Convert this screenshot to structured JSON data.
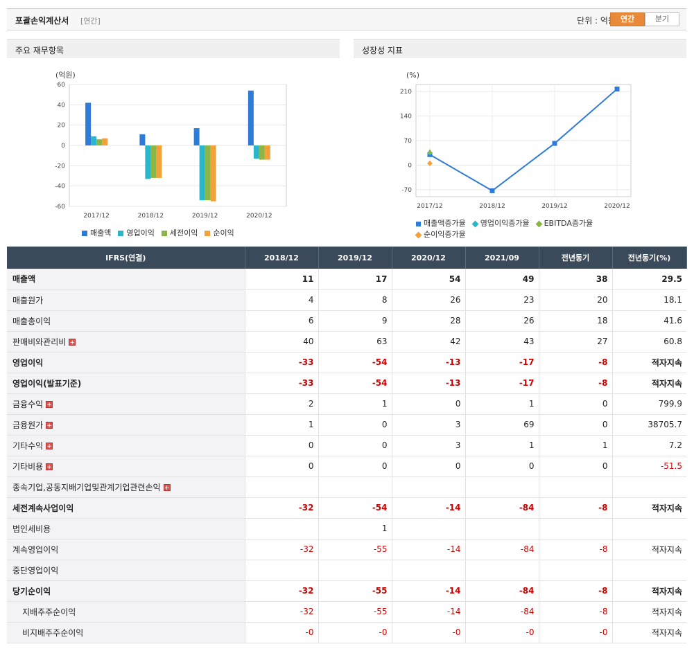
{
  "header": {
    "title": "포괄손익계산서",
    "period_tag": "[연간]",
    "unit": "단위 : 억원",
    "tabs": [
      {
        "label": "연간",
        "active": true
      },
      {
        "label": "분기",
        "active": false
      }
    ]
  },
  "left_panel": {
    "title": "주요 재무항목"
  },
  "right_panel": {
    "title": "성장성 지표"
  },
  "chart_data": [
    {
      "type": "bar",
      "unit_label": "(억원)",
      "categories": [
        "2017/12",
        "2018/12",
        "2019/12",
        "2020/12"
      ],
      "ylim": [
        -60,
        60
      ],
      "yticks": [
        60,
        40,
        20,
        0,
        -20,
        -40,
        -60
      ],
      "grid": true,
      "legend_position": "bottom",
      "series": [
        {
          "name": "매출액",
          "color": "#2f7bd8",
          "values": [
            42,
            11,
            17,
            54
          ]
        },
        {
          "name": "영업이익",
          "color": "#2bb7c9",
          "values": [
            9,
            -33,
            -54,
            -13
          ]
        },
        {
          "name": "세전이익",
          "color": "#8bb544",
          "values": [
            6,
            -32,
            -54,
            -14
          ]
        },
        {
          "name": "순이익",
          "color": "#f2a23a",
          "values": [
            7,
            -32,
            -55,
            -14
          ]
        }
      ]
    },
    {
      "type": "line",
      "unit_label": "(%)",
      "categories": [
        "2017/12",
        "2018/12",
        "2019/12",
        "2020/12"
      ],
      "ylim": [
        -90,
        230
      ],
      "yticks": [
        210,
        140,
        70,
        0,
        -70
      ],
      "grid": true,
      "legend_position": "bottom",
      "series": [
        {
          "name": "매출액증가율",
          "color": "#2f7bd8",
          "marker": "square",
          "values": [
            30,
            -73,
            62,
            217
          ]
        },
        {
          "name": "영업이익증가율",
          "color": "#2bb7c9",
          "marker": "diamond",
          "values": [
            35,
            null,
            null,
            null
          ]
        },
        {
          "name": "EBITDA증가율",
          "color": "#8bb544",
          "marker": "triangle",
          "values": [
            38,
            null,
            null,
            null
          ]
        },
        {
          "name": "순이익증가율",
          "color": "#f2a23a",
          "marker": "diamond",
          "values": [
            5,
            null,
            null,
            null
          ]
        }
      ]
    }
  ],
  "table": {
    "headers": [
      "IFRS(연결)",
      "2018/12",
      "2019/12",
      "2020/12",
      "2021/09",
      "전년동기",
      "전년동기(%)"
    ],
    "rows": [
      {
        "label": "매출액",
        "bold": true,
        "expand": false,
        "indent": false,
        "values": [
          "11",
          "17",
          "54",
          "49",
          "38",
          "29.5"
        ]
      },
      {
        "label": "매출원가",
        "bold": false,
        "expand": false,
        "indent": false,
        "values": [
          "4",
          "8",
          "26",
          "23",
          "20",
          "18.1"
        ]
      },
      {
        "label": "매출총이익",
        "bold": false,
        "expand": false,
        "indent": false,
        "values": [
          "6",
          "9",
          "28",
          "26",
          "18",
          "41.6"
        ]
      },
      {
        "label": "판매비와관리비",
        "bold": false,
        "expand": true,
        "indent": false,
        "values": [
          "40",
          "63",
          "42",
          "43",
          "27",
          "60.8"
        ]
      },
      {
        "label": "영업이익",
        "bold": true,
        "expand": false,
        "indent": false,
        "values": [
          "-33",
          "-54",
          "-13",
          "-17",
          "-8",
          "적자지속"
        ]
      },
      {
        "label": "영업이익(발표기준)",
        "bold": true,
        "expand": false,
        "indent": false,
        "values": [
          "-33",
          "-54",
          "-13",
          "-17",
          "-8",
          "적자지속"
        ]
      },
      {
        "label": "금융수익",
        "bold": false,
        "expand": true,
        "indent": false,
        "values": [
          "2",
          "1",
          "0",
          "1",
          "0",
          "799.9"
        ]
      },
      {
        "label": "금융원가",
        "bold": false,
        "expand": true,
        "indent": false,
        "values": [
          "1",
          "0",
          "3",
          "69",
          "0",
          "38705.7"
        ]
      },
      {
        "label": "기타수익",
        "bold": false,
        "expand": true,
        "indent": false,
        "values": [
          "0",
          "0",
          "3",
          "1",
          "1",
          "7.2"
        ]
      },
      {
        "label": "기타비용",
        "bold": false,
        "expand": true,
        "indent": false,
        "values": [
          "0",
          "0",
          "0",
          "0",
          "0",
          "-51.5"
        ]
      },
      {
        "label": "종속기업,공동지배기업및관계기업관련손익",
        "bold": false,
        "expand": true,
        "indent": false,
        "values": [
          "",
          "",
          "",
          "",
          "",
          ""
        ]
      },
      {
        "label": "세전계속사업이익",
        "bold": true,
        "expand": false,
        "indent": false,
        "values": [
          "-32",
          "-54",
          "-14",
          "-84",
          "-8",
          "적자지속"
        ]
      },
      {
        "label": "법인세비용",
        "bold": false,
        "expand": false,
        "indent": false,
        "values": [
          "",
          "1",
          "",
          "",
          "",
          ""
        ]
      },
      {
        "label": "계속영업이익",
        "bold": false,
        "expand": false,
        "indent": false,
        "values": [
          "-32",
          "-55",
          "-14",
          "-84",
          "-8",
          "적자지속"
        ]
      },
      {
        "label": "중단영업이익",
        "bold": false,
        "expand": false,
        "indent": false,
        "values": [
          "",
          "",
          "",
          "",
          "",
          ""
        ]
      },
      {
        "label": "당기순이익",
        "bold": true,
        "expand": false,
        "indent": false,
        "values": [
          "-32",
          "-55",
          "-14",
          "-84",
          "-8",
          "적자지속"
        ]
      },
      {
        "label": "지배주주순이익",
        "bold": false,
        "expand": false,
        "indent": true,
        "values": [
          "-32",
          "-55",
          "-14",
          "-84",
          "-8",
          "적자지속"
        ]
      },
      {
        "label": "비지배주주순이익",
        "bold": false,
        "expand": false,
        "indent": true,
        "values": [
          "-0",
          "-0",
          "-0",
          "-0",
          "-0",
          "적자지속"
        ]
      }
    ],
    "expand_icon": "plus-box-icon"
  }
}
